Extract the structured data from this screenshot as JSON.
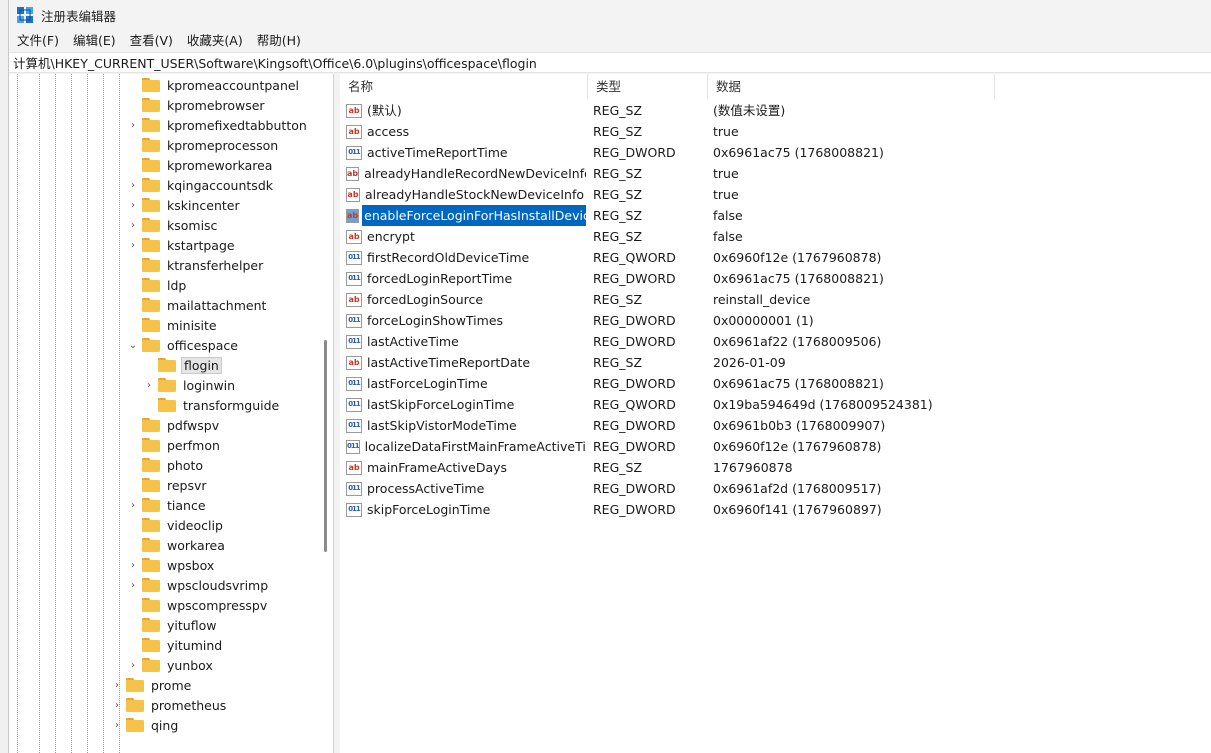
{
  "window": {
    "title": "注册表编辑器"
  },
  "menu": [
    "文件(F)",
    "编辑(E)",
    "查看(V)",
    "收藏夹(A)",
    "帮助(H)"
  ],
  "address": "计算机\\HKEY_CURRENT_USER\\Software\\Kingsoft\\Office\\6.0\\plugins\\officespace\\flogin",
  "tree": {
    "nodes": [
      {
        "label": "kpromeaccountpanel",
        "depth": 0,
        "chevron": ""
      },
      {
        "label": "kpromebrowser",
        "depth": 0,
        "chevron": ""
      },
      {
        "label": "kpromefixedtabbutton",
        "depth": 0,
        "chevron": "›"
      },
      {
        "label": "kpromeprocesson",
        "depth": 0,
        "chevron": ""
      },
      {
        "label": "kpromeworkarea",
        "depth": 0,
        "chevron": ""
      },
      {
        "label": "kqingaccountsdk",
        "depth": 0,
        "chevron": "›"
      },
      {
        "label": "kskincenter",
        "depth": 0,
        "chevron": "›"
      },
      {
        "label": "ksomisc",
        "depth": 0,
        "chevron": "›"
      },
      {
        "label": "kstartpage",
        "depth": 0,
        "chevron": "›"
      },
      {
        "label": "ktransferhelper",
        "depth": 0,
        "chevron": ""
      },
      {
        "label": "ldp",
        "depth": 0,
        "chevron": ""
      },
      {
        "label": "mailattachment",
        "depth": 0,
        "chevron": ""
      },
      {
        "label": "minisite",
        "depth": 0,
        "chevron": ""
      },
      {
        "label": "officespace",
        "depth": 0,
        "chevron": "⌄"
      },
      {
        "label": "flogin",
        "depth": 1,
        "chevron": "",
        "selected": true
      },
      {
        "label": "loginwin",
        "depth": 1,
        "chevron": "›"
      },
      {
        "label": "transformguide",
        "depth": 1,
        "chevron": ""
      },
      {
        "label": "pdfwspv",
        "depth": 0,
        "chevron": ""
      },
      {
        "label": "perfmon",
        "depth": 0,
        "chevron": ""
      },
      {
        "label": "photo",
        "depth": 0,
        "chevron": ""
      },
      {
        "label": "repsvr",
        "depth": 0,
        "chevron": ""
      },
      {
        "label": "tiance",
        "depth": 0,
        "chevron": "›"
      },
      {
        "label": "videoclip",
        "depth": 0,
        "chevron": ""
      },
      {
        "label": "workarea",
        "depth": 0,
        "chevron": ""
      },
      {
        "label": "wpsbox",
        "depth": 0,
        "chevron": "›"
      },
      {
        "label": "wpscloudsvrimp",
        "depth": 0,
        "chevron": "›"
      },
      {
        "label": "wpscompresspv",
        "depth": 0,
        "chevron": ""
      },
      {
        "label": "yituflow",
        "depth": 0,
        "chevron": ""
      },
      {
        "label": "yitumind",
        "depth": 0,
        "chevron": ""
      },
      {
        "label": "yunbox",
        "depth": 0,
        "chevron": "›"
      },
      {
        "label": "prome",
        "depth": -1,
        "chevron": "›"
      },
      {
        "label": "prometheus",
        "depth": -1,
        "chevron": "›"
      },
      {
        "label": "qing",
        "depth": -1,
        "chevron": "›"
      }
    ]
  },
  "list": {
    "headers": {
      "name": "名称",
      "type": "类型",
      "data": "数据"
    },
    "rows": [
      {
        "kind": "sz",
        "name": "(默认)",
        "type": "REG_SZ",
        "data": "(数值未设置)"
      },
      {
        "kind": "sz",
        "name": "access",
        "type": "REG_SZ",
        "data": "true"
      },
      {
        "kind": "bin",
        "name": "activeTimeReportTime",
        "type": "REG_DWORD",
        "data": "0x6961ac75 (1768008821)"
      },
      {
        "kind": "sz",
        "name": "alreadyHandleRecordNewDeviceInfo",
        "type": "REG_SZ",
        "data": "true"
      },
      {
        "kind": "sz",
        "name": "alreadyHandleStockNewDeviceInfo",
        "type": "REG_SZ",
        "data": "true"
      },
      {
        "kind": "sz",
        "name": "enableForceLoginForHasInstallDevice",
        "type": "REG_SZ",
        "data": "false",
        "selected": true
      },
      {
        "kind": "sz",
        "name": "encrypt",
        "type": "REG_SZ",
        "data": "false"
      },
      {
        "kind": "bin",
        "name": "firstRecordOldDeviceTime",
        "type": "REG_QWORD",
        "data": "0x6960f12e (1767960878)"
      },
      {
        "kind": "bin",
        "name": "forcedLoginReportTime",
        "type": "REG_DWORD",
        "data": "0x6961ac75 (1768008821)"
      },
      {
        "kind": "sz",
        "name": "forcedLoginSource",
        "type": "REG_SZ",
        "data": "reinstall_device"
      },
      {
        "kind": "bin",
        "name": "forceLoginShowTimes",
        "type": "REG_DWORD",
        "data": "0x00000001 (1)"
      },
      {
        "kind": "bin",
        "name": "lastActiveTime",
        "type": "REG_DWORD",
        "data": "0x6961af22 (1768009506)"
      },
      {
        "kind": "sz",
        "name": "lastActiveTimeReportDate",
        "type": "REG_SZ",
        "data": "2026-01-09"
      },
      {
        "kind": "bin",
        "name": "lastForceLoginTime",
        "type": "REG_DWORD",
        "data": "0x6961ac75 (1768008821)"
      },
      {
        "kind": "bin",
        "name": "lastSkipForceLoginTime",
        "type": "REG_QWORD",
        "data": "0x19ba594649d (1768009524381)"
      },
      {
        "kind": "bin",
        "name": "lastSkipVistorModeTime",
        "type": "REG_DWORD",
        "data": "0x6961b0b3 (1768009907)"
      },
      {
        "kind": "bin",
        "name": "localizeDataFirstMainFrameActiveTime",
        "type": "REG_DWORD",
        "data": "0x6960f12e (1767960878)"
      },
      {
        "kind": "sz",
        "name": "mainFrameActiveDays",
        "type": "REG_SZ",
        "data": "1767960878"
      },
      {
        "kind": "bin",
        "name": "processActiveTime",
        "type": "REG_DWORD",
        "data": "0x6961af2d (1768009517)"
      },
      {
        "kind": "bin",
        "name": "skipForceLoginTime",
        "type": "REG_DWORD",
        "data": "0x6960f141 (1767960897)"
      }
    ]
  },
  "icons": {
    "value_sz": "string-value-icon",
    "value_bin": "binary-value-icon",
    "folder": "folder-icon",
    "app": "regedit-icon"
  },
  "colors": {
    "selection": "#0067c0",
    "folder": "#f6c34a",
    "sz_icon": "#c0392b",
    "bin_icon": "#2e5fa8"
  }
}
